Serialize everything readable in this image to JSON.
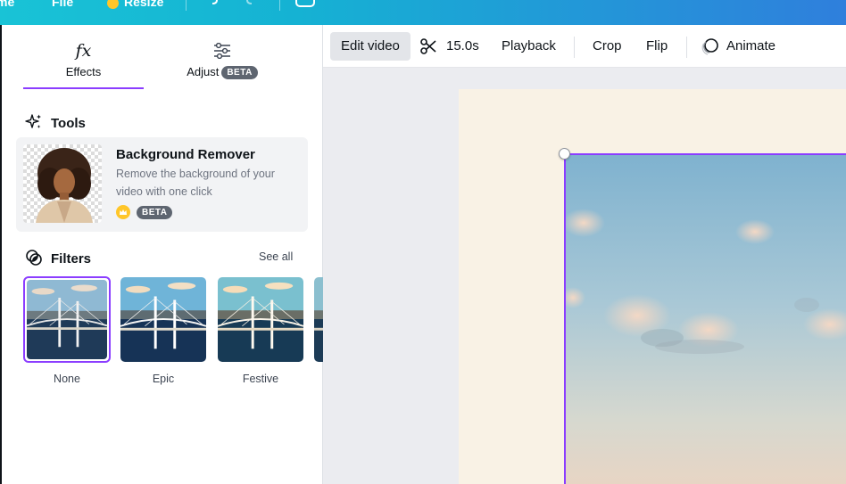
{
  "topbar": {
    "home_label": "me",
    "file_label": "File",
    "resize_label": "Resize"
  },
  "side_panel": {
    "tabs": [
      {
        "label": "Effects",
        "icon": "fx-icon",
        "selected": true
      },
      {
        "label": "Adjust",
        "icon": "sliders-icon",
        "badge": "BETA"
      }
    ],
    "tools": {
      "title": "Tools",
      "card": {
        "title": "Background Remover",
        "description": "Remove the background of your video with one click",
        "badge": "BETA"
      }
    },
    "filters": {
      "title": "Filters",
      "see_all": "See all",
      "items": [
        {
          "label": "None",
          "selected": true
        },
        {
          "label": "Epic"
        },
        {
          "label": "Festive"
        }
      ]
    }
  },
  "toolbar": {
    "edit_video": "Edit video",
    "duration": "15.0s",
    "playback": "Playback",
    "crop": "Crop",
    "flip": "Flip",
    "animate": "Animate"
  },
  "colors": {
    "accent": "#8b3dff",
    "topbar_start": "#19c3d6",
    "topbar_end": "#2f7fdc",
    "canvas_page": "#f9f2e5",
    "premium_crown": "#ffc629"
  }
}
